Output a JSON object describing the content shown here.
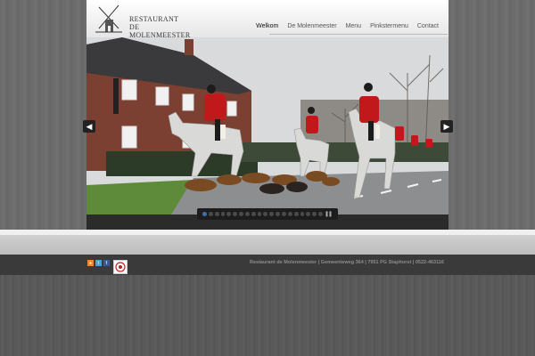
{
  "site": {
    "logo_line1": "RESTAURANT",
    "logo_line2": "DE MOLENMEESTER"
  },
  "nav": {
    "items": [
      "Welkom",
      "De Molenmeester",
      "Menu",
      "Pinkstermenu",
      "Contact"
    ],
    "active_index": 0
  },
  "slider": {
    "prev_icon": "chevron-left-icon",
    "next_icon": "chevron-right-icon",
    "dot_count": 20,
    "active_dot": 0,
    "pause_icon": "pause-icon"
  },
  "footer": {
    "social_icons": [
      "rss-icon",
      "twitter-icon",
      "facebook-icon"
    ],
    "address": "Restaurant de Molenmeester | Gemeenteweg 364 | 7951 PG Staphorst | 0522-463116"
  },
  "colors": {
    "accent_blue": "#3c6fb2",
    "rider_red": "#c0181b"
  }
}
